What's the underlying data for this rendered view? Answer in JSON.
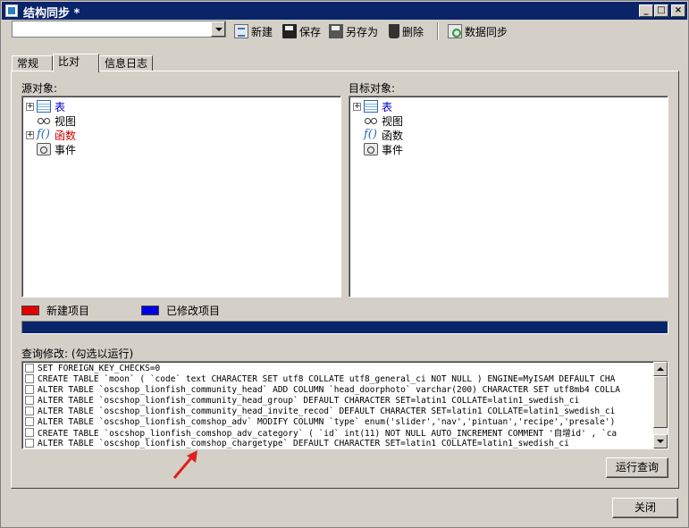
{
  "window": {
    "title": "结构同步 *",
    "min": "_",
    "max": "□",
    "close": "×"
  },
  "toolbar": {
    "combo_value": "",
    "new_label": "新建",
    "save_label": "保存",
    "saveas_label": "另存为",
    "delete_label": "删除",
    "sync_label": "数据同步"
  },
  "tabs": [
    {
      "label": "常规"
    },
    {
      "label": "比对"
    },
    {
      "label": "信息日志"
    }
  ],
  "source": {
    "label": "源对象:",
    "items": [
      {
        "label": "表",
        "color": "#0000cc"
      },
      {
        "label": "视图",
        "color": "#000000"
      },
      {
        "label": "函数",
        "color": "#cc0000"
      },
      {
        "label": "事件",
        "color": "#000000"
      }
    ]
  },
  "target": {
    "label": "目标对象:",
    "items": [
      {
        "label": "表",
        "color": "#0000cc"
      },
      {
        "label": "视图",
        "color": "#000000"
      },
      {
        "label": "函数",
        "color": "#000000"
      },
      {
        "label": "事件",
        "color": "#000000"
      }
    ]
  },
  "legend": {
    "new_label": "新建项目",
    "new_color": "#e00000",
    "modified_label": "已修改项目",
    "modified_color": "#0000e0"
  },
  "query": {
    "label": "查询修改: (勾选以运行)",
    "rows": [
      "SET FOREIGN_KEY_CHECKS=0",
      "CREATE TABLE `moon` ( `code` text CHARACTER SET utf8 COLLATE utf8_general_ci NOT NULL ) ENGINE=MyISAM DEFAULT CHA",
      "ALTER TABLE `oscshop_lionfish_community_head` ADD COLUMN `head_doorphoto` varchar(200) CHARACTER SET utf8mb4 COLLA",
      "ALTER TABLE `oscshop_lionfish_community_head_group` DEFAULT CHARACTER SET=latin1 COLLATE=latin1_swedish_ci",
      "ALTER TABLE `oscshop_lionfish_community_head_invite_recod` DEFAULT CHARACTER SET=latin1 COLLATE=latin1_swedish_ci",
      "ALTER TABLE `oscshop_lionfish_comshop_adv` MODIFY COLUMN `type` enum('slider','nav','pintuan','recipe','presale')",
      "CREATE TABLE `oscshop_lionfish_comshop_adv_category` ( `id` int(11) NOT NULL AUTO_INCREMENT COMMENT '自增id' , `ca",
      "ALTER TABLE `oscshop_lionfish_comshop_chargetype` DEFAULT CHARACTER SET=latin1 COLLATE=latin1_swedish_ci"
    ],
    "run_label": "运行查询"
  },
  "close_label": "关闭",
  "annotation_color": "#e02020"
}
